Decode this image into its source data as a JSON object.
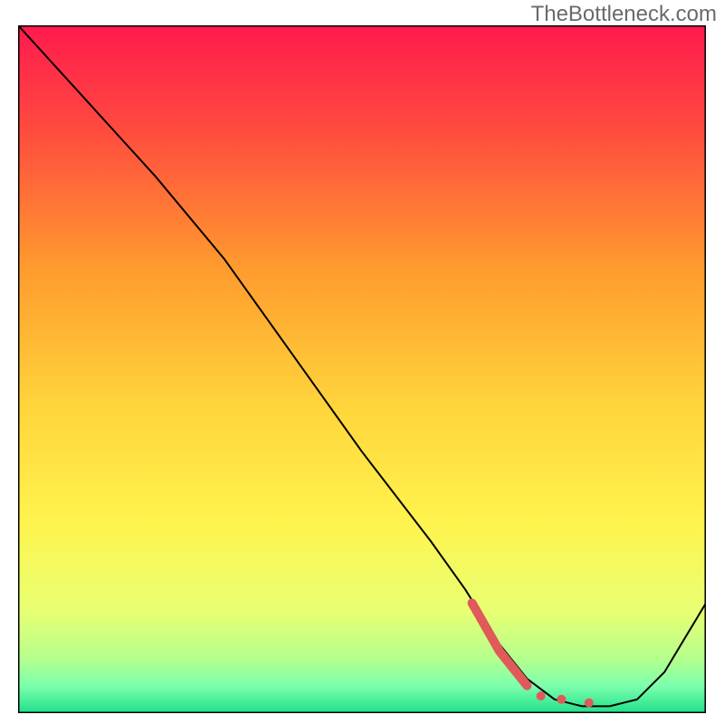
{
  "watermark": "TheBottleneck.com",
  "chart_data": {
    "type": "line",
    "title": "",
    "xlabel": "",
    "ylabel": "",
    "xlim": [
      0,
      100
    ],
    "ylim": [
      0,
      100
    ],
    "legend": false,
    "grid": false,
    "background": {
      "type": "vertical-gradient",
      "stops": [
        {
          "offset": 0,
          "color": "#ff1a4d"
        },
        {
          "offset": 15,
          "color": "#ff4a3f"
        },
        {
          "offset": 35,
          "color": "#ff9a2e"
        },
        {
          "offset": 55,
          "color": "#ffd43b"
        },
        {
          "offset": 72,
          "color": "#fff34d"
        },
        {
          "offset": 85,
          "color": "#e9ff72"
        },
        {
          "offset": 92,
          "color": "#b6ff8c"
        },
        {
          "offset": 96,
          "color": "#7dffad"
        },
        {
          "offset": 100,
          "color": "#1fe08a"
        }
      ]
    },
    "series": [
      {
        "name": "bottleneck-curve",
        "color": "#000000",
        "stroke_width": 2,
        "x": [
          0,
          10,
          20,
          30,
          40,
          50,
          60,
          65,
          70,
          74,
          78,
          82,
          86,
          90,
          94,
          100
        ],
        "y": [
          100,
          89,
          78,
          66,
          52,
          38,
          25,
          18,
          10,
          5,
          2,
          1,
          1,
          2,
          6,
          16
        ]
      },
      {
        "name": "highlight-segment",
        "color": "#e05a5a",
        "stroke_width": 10,
        "x": [
          66,
          70,
          74
        ],
        "y": [
          16,
          9,
          4
        ]
      }
    ],
    "markers": [
      {
        "x": 76,
        "y": 2.5,
        "r": 5,
        "color": "#e05a5a"
      },
      {
        "x": 79,
        "y": 2.0,
        "r": 5,
        "color": "#e05a5a"
      },
      {
        "x": 83,
        "y": 1.5,
        "r": 5,
        "color": "#e05a5a"
      }
    ]
  }
}
